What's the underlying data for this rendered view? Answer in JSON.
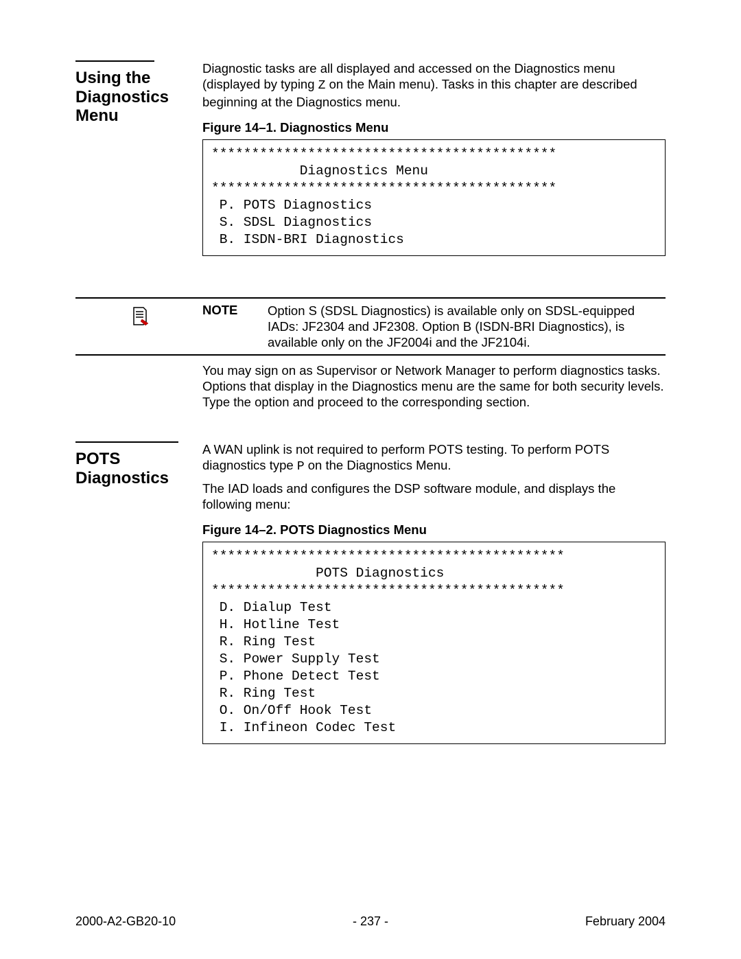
{
  "section1": {
    "title": "Using the Diagnostics Menu",
    "para_before_z": "Diagnostic tasks are all displayed and accessed on the Diagnostics menu (displayed by typing ",
    "z_char": "Z",
    "para_after_z": " on the Main menu). Tasks in this chapter are described beginning at the Diagnostics menu.",
    "figure_caption": "Figure 14–1. Diagnostics Menu",
    "menu_text": "*******************************************\n           Diagnostics Menu\n*******************************************\n P. POTS Diagnostics\n S. SDSL Diagnostics\n B. ISDN-BRI Diagnostics"
  },
  "note": {
    "label": "NOTE",
    "text": "Option S (SDSL Diagnostics) is available only on SDSL-equipped IADs: JF2304 and JF2308. Option B (ISDN-BRI Diagnostics), is available only on the JF2004i and the JF2104i.",
    "after_text": "You may sign on as Supervisor or Network Manager to perform diagnostics tasks. Options that display in the Diagnostics menu are the same for both security levels. Type the option and proceed to the corresponding section."
  },
  "section2": {
    "title": "POTS Diagnostics",
    "para1_before_p": "A WAN uplink is not required to perform POTS testing. To perform POTS diagnostics type ",
    "p_char": "P",
    "para1_after_p": " on the Diagnostics Menu.",
    "para2": "The IAD loads and configures the DSP software module, and displays the following menu:",
    "figure_caption": "Figure 14–2. POTS Diagnostics Menu",
    "menu_text": "********************************************\n             POTS Diagnostics\n********************************************\n D. Dialup Test\n H. Hotline Test\n R. Ring Test\n S. Power Supply Test\n P. Phone Detect Test\n R. Ring Test\n O. On/Off Hook Test\n I. Infineon Codec Test"
  },
  "footer": {
    "left": "2000-A2-GB20-10",
    "center": "- 237 -",
    "right": "February 2004"
  }
}
